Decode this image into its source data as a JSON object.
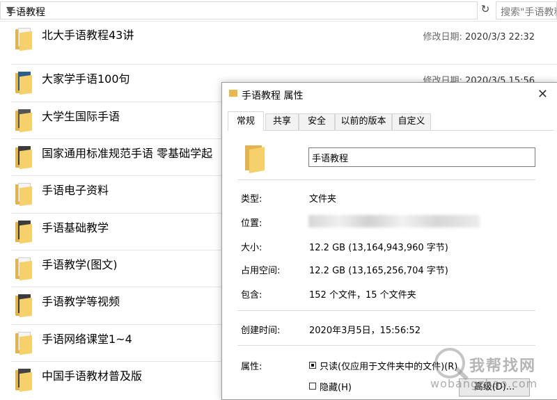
{
  "address_bar": {
    "path": "手语教程",
    "search_placeholder": "搜索\"手语教程\""
  },
  "file_list": {
    "date_label": "修改日期:",
    "items": [
      {
        "name": "北大手语教程43讲",
        "date": "2020/3/3 22:32"
      },
      {
        "name": "大家学手语100句",
        "date": "2020/3/5 15:56"
      },
      {
        "name": "大学生国际手语"
      },
      {
        "name": "国家通用标准规范手语 零基础学起"
      },
      {
        "name": "手语电子资料"
      },
      {
        "name": "手语基础教学"
      },
      {
        "name": "手语教学(图文)"
      },
      {
        "name": "手语教学等视频"
      },
      {
        "name": "手语网络课堂1~4"
      },
      {
        "name": "中国手语教材普及版"
      }
    ]
  },
  "dialog": {
    "title": "手语教程 属性",
    "close_glyph": "✕",
    "tabs": [
      "常规",
      "共享",
      "安全",
      "以前的版本",
      "自定义"
    ],
    "folder_name": "手语教程",
    "type_label": "类型:",
    "type_value": "文件夹",
    "location_label": "位置:",
    "size_label": "大小:",
    "size_value": "12.2 GB (13,164,943,960 字节)",
    "disk_label": "占用空间:",
    "disk_value": "12.2 GB (13,165,256,704 字节)",
    "contains_label": "包含:",
    "contains_value": "152 个文件，15 个文件夹",
    "created_label": "创建时间:",
    "created_value": "2020年3月5日，15:56:52",
    "attr_label": "属性:",
    "readonly_label": "只读(仅应用于文件夹中的文件)(R)",
    "hidden_label": "隐藏(H)",
    "advanced_label": "高级(D)..."
  },
  "watermark": {
    "text": "我帮找网",
    "url": "wobangzhao.com"
  },
  "colors": {
    "folder_back": "#e2b34e",
    "folder_front": "#f6d06a"
  }
}
